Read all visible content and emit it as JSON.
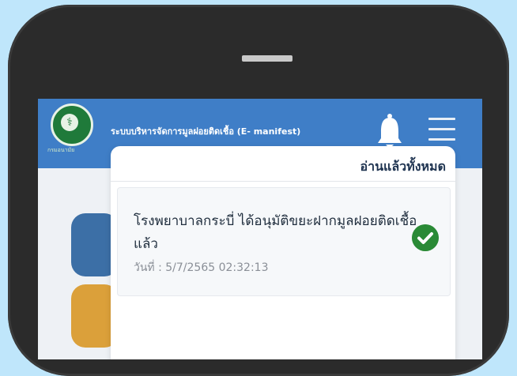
{
  "app": {
    "title": "ระบบบริหารจัดการมูลฝอยติดเชื้อ (E- manifest)",
    "logo_text": "กรมอนามัย"
  },
  "icons": {
    "logo": "ministry-seal-icon",
    "bell": "bell-icon",
    "menu": "hamburger-menu-icon",
    "check": "check-circle-icon"
  },
  "colors": {
    "appbar": "#3f7ec7",
    "tile_blue": "#3c6fa6",
    "tile_orange": "#dba03a",
    "check": "#2a8a36"
  },
  "notifications": {
    "mark_all_read_label": "อ่านแล้วทั้งหมด",
    "items": [
      {
        "message": "โรงพยาบาลกระบี่ ได้อนุมัติขยะฝากมูลฝอยติดเชื้อแล้ว",
        "date": "วันที่ : 5/7/2565 02:32:13",
        "status_icon": "check-circle-icon"
      }
    ]
  }
}
